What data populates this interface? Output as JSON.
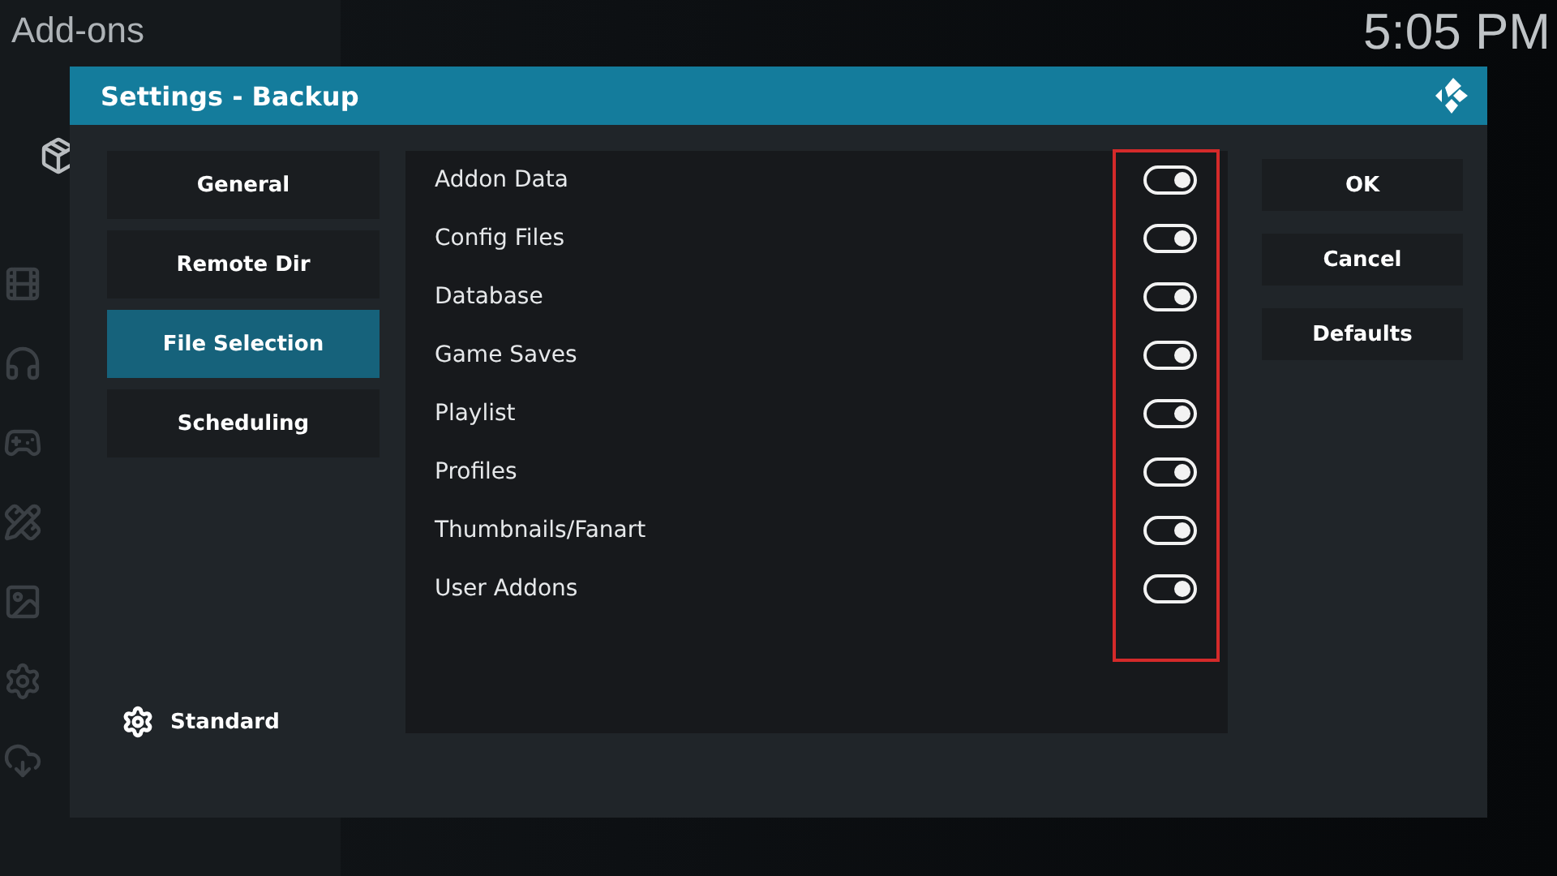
{
  "header": {
    "title": "Add-ons",
    "clock": "5:05 PM"
  },
  "dialog": {
    "title": "Settings - Backup"
  },
  "categories": [
    {
      "label": "General",
      "selected": false
    },
    {
      "label": "Remote Dir",
      "selected": false
    },
    {
      "label": "File Selection",
      "selected": true
    },
    {
      "label": "Scheduling",
      "selected": false
    }
  ],
  "level": "Standard",
  "settings": [
    {
      "label": "Addon Data",
      "on": true
    },
    {
      "label": "Config Files",
      "on": true
    },
    {
      "label": "Database",
      "on": true
    },
    {
      "label": "Game Saves",
      "on": true
    },
    {
      "label": "Playlist",
      "on": true
    },
    {
      "label": "Profiles",
      "on": true
    },
    {
      "label": "Thumbnails/Fanart",
      "on": true
    },
    {
      "label": "User Addons",
      "on": true
    }
  ],
  "buttons": [
    "OK",
    "Cancel",
    "Defaults"
  ]
}
